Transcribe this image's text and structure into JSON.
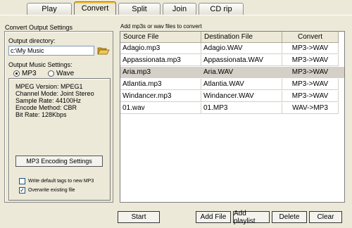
{
  "tabs": [
    "Play",
    "Convert",
    "Split",
    "Join",
    "CD rip"
  ],
  "active_tab": "Convert",
  "left": {
    "title": "Convert Output Settings",
    "output_dir_label": "Output directory:",
    "output_dir_value": "c:\\My Music",
    "music_settings_label": "Output Music Settings:",
    "radio_mp3": "MP3",
    "radio_wave": "Wave",
    "selected_format": "MP3",
    "info": [
      "MPEG Version:  MPEG1",
      "Channel Mode: Joint Stereo",
      "Sample Rate:  44100Hz",
      "Encode Method: CBR",
      "Bit Rate:  128Kbps"
    ],
    "encoding_button": "MP3 Encoding Settings",
    "check_default_tags": "Write default tags to new MP3",
    "check_default_tags_checked": false,
    "check_overwrite": "Overwrite existing file",
    "check_overwrite_checked": true
  },
  "right": {
    "title": "Add mp3s or wav files to convert",
    "columns": [
      "Source File",
      "Destination File",
      "Convert"
    ],
    "rows": [
      [
        "Adagio.mp3",
        "Adagio.WAV",
        "MP3->WAV"
      ],
      [
        "Appassionata.mp3",
        "Appassionata.WAV",
        "MP3->WAV"
      ],
      [
        "Aria.mp3",
        "Aria.WAV",
        "MP3->WAV"
      ],
      [
        "Atlantia.mp3",
        "Atlantia.WAV",
        "MP3->WAV"
      ],
      [
        "Windancer.mp3",
        "Windancer.WAV",
        "MP3->WAV"
      ],
      [
        "01.wav",
        "01.MP3",
        "WAV->MP3"
      ]
    ],
    "selected_row": 2
  },
  "buttons": {
    "start": "Start",
    "add_file": "Add File",
    "add_playlist": "Add playlist",
    "delete": "Delete",
    "clear": "Clear"
  },
  "icons": {
    "folder": "folder-open-icon"
  }
}
